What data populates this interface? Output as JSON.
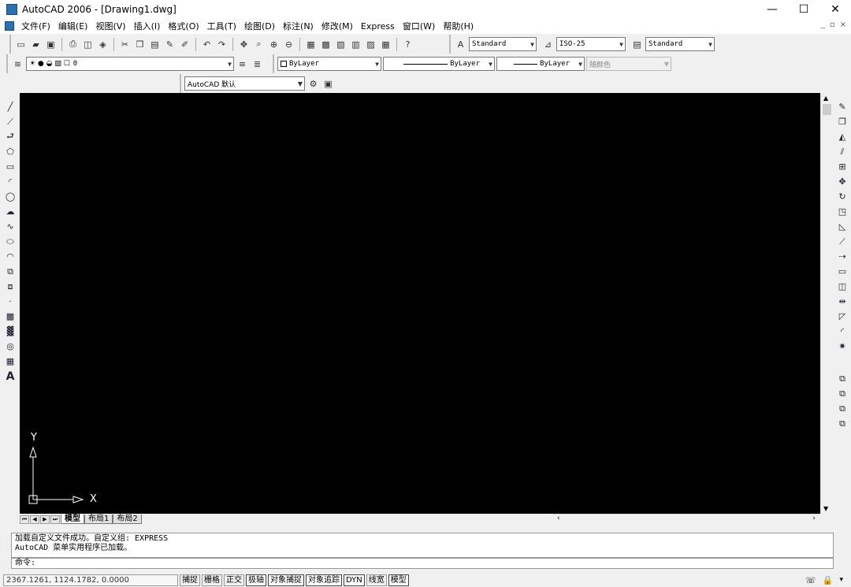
{
  "window": {
    "title": "AutoCAD 2006 - [Drawing1.dwg]",
    "minimize": "—",
    "maximize": "☐",
    "close": "✕"
  },
  "menu": [
    "文件(F)",
    "编辑(E)",
    "视图(V)",
    "插入(I)",
    "格式(O)",
    "工具(T)",
    "绘图(D)",
    "标注(N)",
    "修改(M)",
    "Express",
    "窗口(W)",
    "帮助(H)"
  ],
  "doc_controls": {
    "min": "_",
    "restore": "▫",
    "close": "×"
  },
  "styles": {
    "text_style": "Standard",
    "dim_style": "ISO-25",
    "table_style": "Standard"
  },
  "layers": {
    "current": "0"
  },
  "properties": {
    "color": "ByLayer",
    "linetype": "ByLayer",
    "lineweight": "ByLayer",
    "plotstyle": "随颜色"
  },
  "workspace": {
    "current": "AutoCAD 默认"
  },
  "ucs": {
    "x_label": "X",
    "y_label": "Y"
  },
  "layout_tabs": [
    {
      "label": "模型",
      "active": true
    },
    {
      "label": "布局1",
      "active": false
    },
    {
      "label": "布局2",
      "active": false
    }
  ],
  "command": {
    "history": [
      "加载自定义文件成功。自定义组: EXPRESS",
      "AutoCAD 菜单实用程序已加载。"
    ],
    "prompt": "命令:"
  },
  "status": {
    "coords": "2367.1261,  1124.1782,  0.0000",
    "buttons": [
      "捕捉",
      "栅格",
      "正交",
      "极轴",
      "对象捕捉",
      "对象追踪",
      "DYN",
      "线宽",
      "模型"
    ]
  }
}
